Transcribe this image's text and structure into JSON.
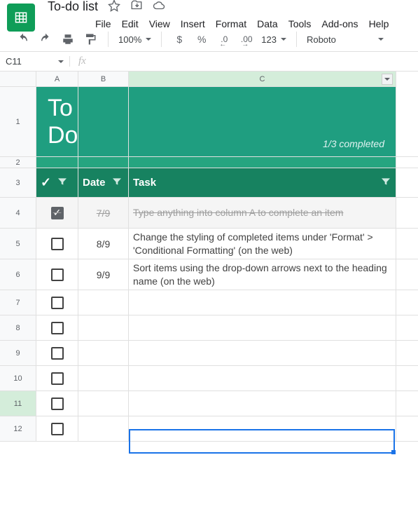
{
  "doc": {
    "title": "To-do list"
  },
  "menus": {
    "file": "File",
    "edit": "Edit",
    "view": "View",
    "insert": "Insert",
    "format": "Format",
    "data": "Data",
    "tools": "Tools",
    "addons": "Add-ons",
    "help": "Help"
  },
  "toolbar": {
    "zoom": "100%",
    "currency": "$",
    "percent": "%",
    "dec_less": ".0",
    "dec_more": ".00",
    "numfmt": "123",
    "font": "Roboto"
  },
  "namebox": {
    "cell": "C11"
  },
  "fx": {
    "label": "fx"
  },
  "cols": {
    "a": "A",
    "b": "B",
    "c": "C"
  },
  "rowNums": [
    "1",
    "2",
    "3",
    "4",
    "5",
    "6",
    "7",
    "8",
    "9",
    "10",
    "11",
    "12"
  ],
  "header": {
    "title": "To Do",
    "progress": "1/3 completed"
  },
  "columns": {
    "check": "✓",
    "date": "Date",
    "task": "Task"
  },
  "items": [
    {
      "done": true,
      "date": "7/9",
      "task": "Type anything into column A to complete an item"
    },
    {
      "done": false,
      "date": "8/9",
      "task": "Change the styling of completed items under 'Format' > 'Conditional Formatting' (on the web)"
    },
    {
      "done": false,
      "date": "9/9",
      "task": "Sort items using the drop-down arrows next to the heading name (on the web)"
    }
  ]
}
